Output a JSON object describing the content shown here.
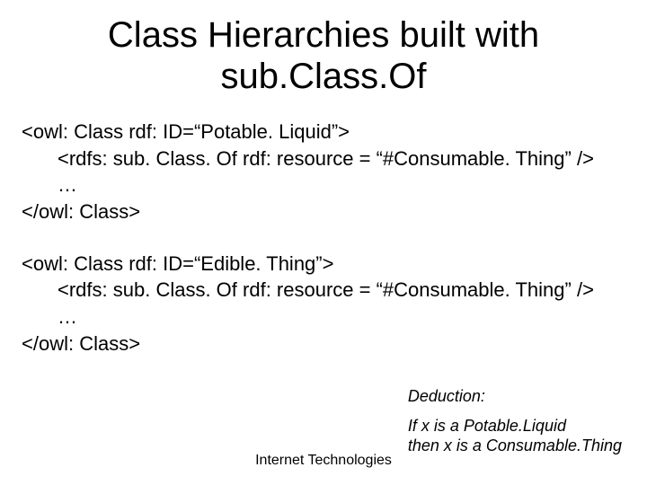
{
  "title": "Class Hierarchies built with sub.Class.Of",
  "block1": {
    "l1": "<owl: Class rdf: ID=“Potable. Liquid”>",
    "l2": "<rdfs: sub. Class. Of rdf: resource = “#Consumable. Thing” />",
    "l3": "…",
    "l4": "</owl: Class>"
  },
  "block2": {
    "l1": "<owl: Class rdf: ID=“Edible. Thing”>",
    "l2": "<rdfs: sub. Class. Of rdf: resource = “#Consumable. Thing” />",
    "l3": "…",
    "l4": "</owl: Class>"
  },
  "deduction": {
    "label": "Deduction:",
    "line1": "If x is a Potable.Liquid",
    "line2": "then x is a Consumable.Thing"
  },
  "footer": "Internet Technologies"
}
